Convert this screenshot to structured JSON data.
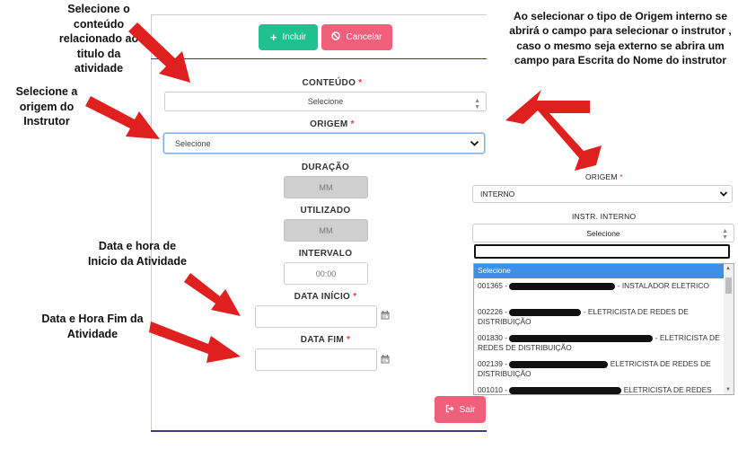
{
  "form": {
    "incluir_label": "Incluir",
    "cancelar_label": "Cancelar",
    "conteudo_label": "CONTEÚDO",
    "conteudo_value": "Selecione",
    "origem_label": "ORIGEM",
    "origem_value": "Selecione",
    "duracao_label": "DURAÇÃO",
    "duracao_placeholder": "MM",
    "utilizado_label": "UTILIZADO",
    "utilizado_placeholder": "MM",
    "intervalo_label": "INTERVALO",
    "intervalo_value": "00:00",
    "data_inicio_label": "DATA INÍCIO",
    "data_fim_label": "DATA FIM",
    "required_mark": "*",
    "sair_label": "Sair"
  },
  "panel": {
    "origem_label": "ORIGEM",
    "origem_value": "INTERNO",
    "instr_label": "INSTR. INTERNO",
    "instr_value": "Selecione",
    "options": [
      {
        "prefix": "Selecione",
        "suffix": ""
      },
      {
        "prefix": "001365 -",
        "suffix": "- INSTALADOR ELETRICO"
      },
      {
        "prefix": "002226 -",
        "suffix": "- ELETRICISTA DE REDES DE DISTRIBUIÇÃO"
      },
      {
        "prefix": "001830 -",
        "suffix": "- ELETRICISTA DE REDES DE DISTRIBUIÇÃO"
      },
      {
        "prefix": "002139 -",
        "suffix": "ELETRICISTA DE REDES DE DISTRIBUIÇÃO"
      },
      {
        "prefix": "001010 -",
        "suffix": "ELETRICISTA DE REDES"
      }
    ]
  },
  "annotations": {
    "conteudo_note": "Selecione o conteúdo relacionado ao titulo da atividade",
    "origem_note": "Selecione a origem do Instrutor",
    "inicio_note": "Data e hora de Inicio da Atividade",
    "fim_note": "Data e Hora Fim da Atividade",
    "interno_note": "Ao selecionar o tipo de Origem interno se abrirá o campo para selecionar o instrutor , caso o mesmo seja externo se abrira um campo para Escrita do Nome do instrutor"
  },
  "colors": {
    "success": "#1fc18e",
    "danger": "#f0607a",
    "arrow": "#e0201f",
    "selected_option": "#3d8fe8"
  },
  "icons": [
    "plus-icon",
    "ban-icon",
    "calendar-icon",
    "exit-icon",
    "chevron-down-icon"
  ]
}
